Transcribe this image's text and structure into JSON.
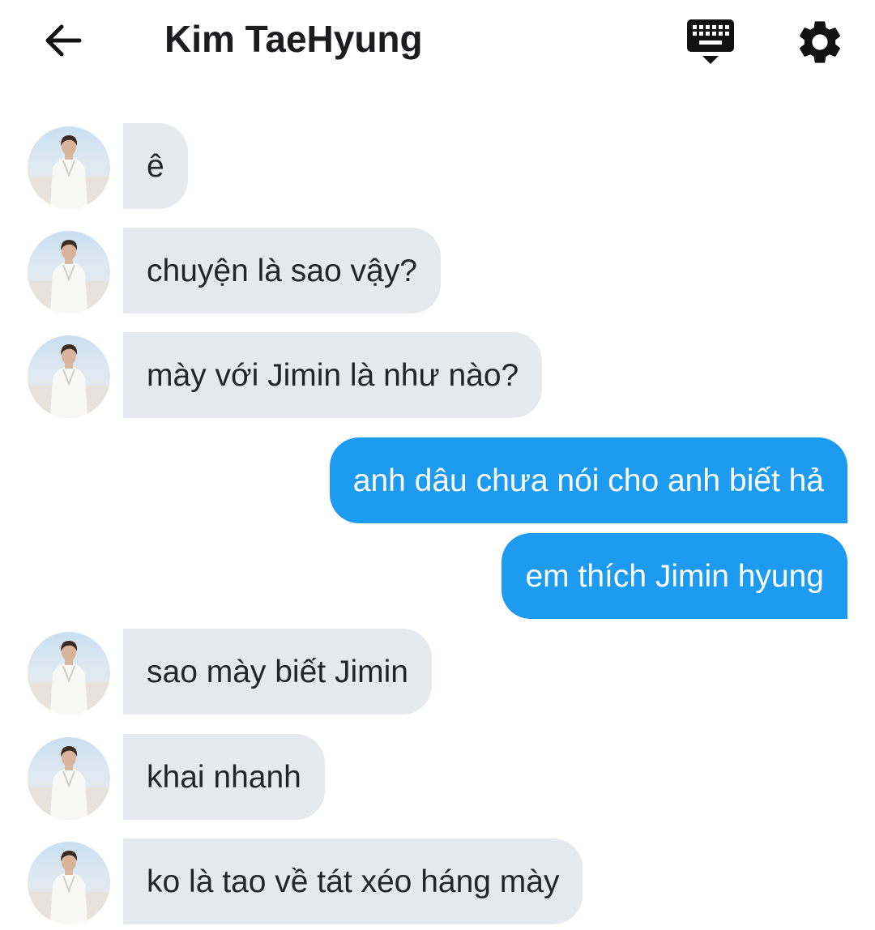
{
  "header": {
    "title": "Kim TaeHyung",
    "back_icon": "arrow-left-icon",
    "keyboard_icon": "keyboard-hide-icon",
    "settings_icon": "gear-icon"
  },
  "messages": [
    {
      "direction": "in",
      "text": "ê"
    },
    {
      "direction": "in",
      "text": "chuyện là sao vậy?"
    },
    {
      "direction": "in",
      "text": "mày với Jimin là như nào?"
    },
    {
      "direction": "out",
      "text": "anh dâu chưa nói cho anh biết hả"
    },
    {
      "direction": "out",
      "text": "em thích Jimin hyung"
    },
    {
      "direction": "in",
      "text": "sao mày biết Jimin"
    },
    {
      "direction": "in",
      "text": "khai nhanh"
    },
    {
      "direction": "in",
      "text": "ko là tao về tát xéo háng mày"
    }
  ],
  "colors": {
    "incoming_bubble": "#e6e9ed",
    "incoming_text": "#232628",
    "outgoing_bubble": "#1d9bf0",
    "outgoing_text": "#ffffff",
    "title": "#1c1c1e"
  }
}
